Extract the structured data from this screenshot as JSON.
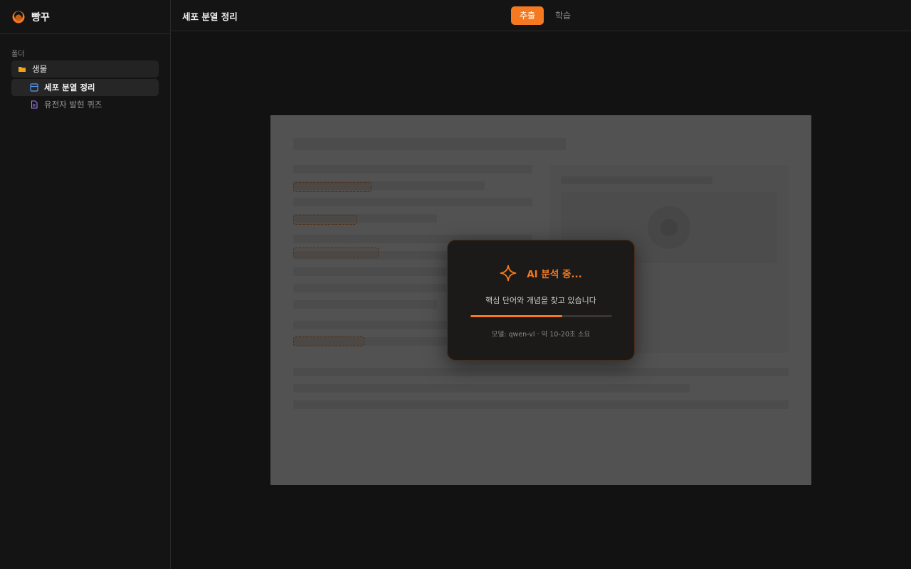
{
  "app": {
    "name": "빵꾸"
  },
  "sidebar": {
    "section_label": "폴더",
    "folder": {
      "label": "생물",
      "icon": "folder-icon"
    },
    "items": [
      {
        "label": "세포 분열 정리",
        "icon": "document-layout-icon",
        "active": true
      },
      {
        "label": "유전자 발현 퀴즈",
        "icon": "file-text-icon",
        "active": false
      }
    ]
  },
  "header": {
    "title": "세포 분열 정리",
    "tabs": [
      {
        "label": "추출",
        "active": true
      },
      {
        "label": "학습",
        "active": false
      }
    ]
  },
  "dialog": {
    "title": "AI 분석 중...",
    "subtitle": "핵심 단어와 개념을 찾고 있습니다",
    "progress": 0.65,
    "meta": "모델: qwen-vl · 약 10-20초 소요",
    "icon": "sparkle-icon"
  },
  "colors": {
    "accent": "#f47920",
    "background": "#121212",
    "sidebar": "#141414"
  }
}
